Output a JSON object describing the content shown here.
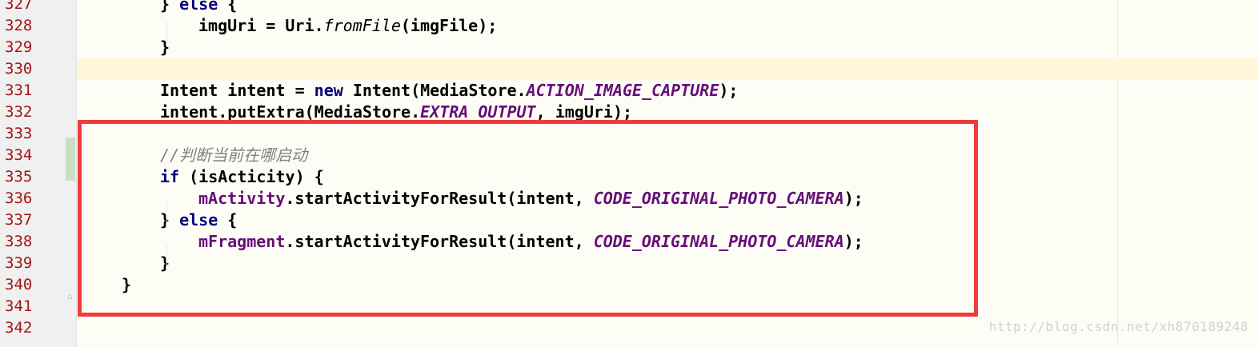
{
  "editor": {
    "lines": [
      {
        "num": "327",
        "tokens": [
          {
            "t": "} ",
            "c": ""
          },
          {
            "t": "else",
            "c": "kw"
          },
          {
            "t": " {",
            "c": ""
          }
        ]
      },
      {
        "num": "328",
        "tokens": [
          {
            "t": "imgUri = Uri.",
            "c": ""
          },
          {
            "t": "fromFile",
            "c": "method-it"
          },
          {
            "t": "(imgFile);",
            "c": ""
          }
        ]
      },
      {
        "num": "329",
        "tokens": [
          {
            "t": "}",
            "c": ""
          }
        ]
      },
      {
        "num": "330",
        "tokens": []
      },
      {
        "num": "331",
        "tokens": [
          {
            "t": "Intent intent = ",
            "c": ""
          },
          {
            "t": "new",
            "c": "kw"
          },
          {
            "t": " Intent(MediaStore.",
            "c": ""
          },
          {
            "t": "ACTION_IMAGE_CAPTURE",
            "c": "static"
          },
          {
            "t": ");",
            "c": ""
          }
        ]
      },
      {
        "num": "332",
        "tokens": [
          {
            "t": "intent.putExtra(MediaStore.",
            "c": ""
          },
          {
            "t": "EXTRA_OUTPUT",
            "c": "static"
          },
          {
            "t": ", imgUri);",
            "c": ""
          }
        ]
      },
      {
        "num": "333",
        "tokens": []
      },
      {
        "num": "334",
        "tokens": [
          {
            "t": "//判断当前在哪启动",
            "c": "cmt"
          }
        ]
      },
      {
        "num": "335",
        "tokens": [
          {
            "t": "if",
            "c": "kw"
          },
          {
            "t": " (isActicity) {",
            "c": ""
          }
        ]
      },
      {
        "num": "336",
        "tokens": [
          {
            "t": "mActivity",
            "c": "field"
          },
          {
            "t": ".startActivityForResult(intent, ",
            "c": ""
          },
          {
            "t": "CODE_ORIGINAL_PHOTO_CAMERA",
            "c": "static"
          },
          {
            "t": ");",
            "c": ""
          }
        ]
      },
      {
        "num": "337",
        "tokens": [
          {
            "t": "} ",
            "c": ""
          },
          {
            "t": "else",
            "c": "kw"
          },
          {
            "t": " {",
            "c": ""
          }
        ]
      },
      {
        "num": "338",
        "tokens": [
          {
            "t": "mFragment",
            "c": "field"
          },
          {
            "t": ".startActivityForResult(intent, ",
            "c": ""
          },
          {
            "t": "CODE_ORIGINAL_PHOTO_CAMERA",
            "c": "static"
          },
          {
            "t": ");",
            "c": ""
          }
        ]
      },
      {
        "num": "339",
        "tokens": [
          {
            "t": "}",
            "c": ""
          }
        ]
      },
      {
        "num": "340",
        "tokens": [
          {
            "t": "}",
            "c": ""
          }
        ]
      },
      {
        "num": "341",
        "tokens": []
      },
      {
        "num": "342",
        "tokens": []
      }
    ],
    "watermark": "http://blog.csdn.net/xh870189248",
    "colors": {
      "highlight_box": "#ef3b3b",
      "line_number": "#a31515",
      "keyword": "#000080",
      "constant": "#660e7a",
      "comment": "#808080",
      "current_line": "#fff6dc"
    }
  }
}
